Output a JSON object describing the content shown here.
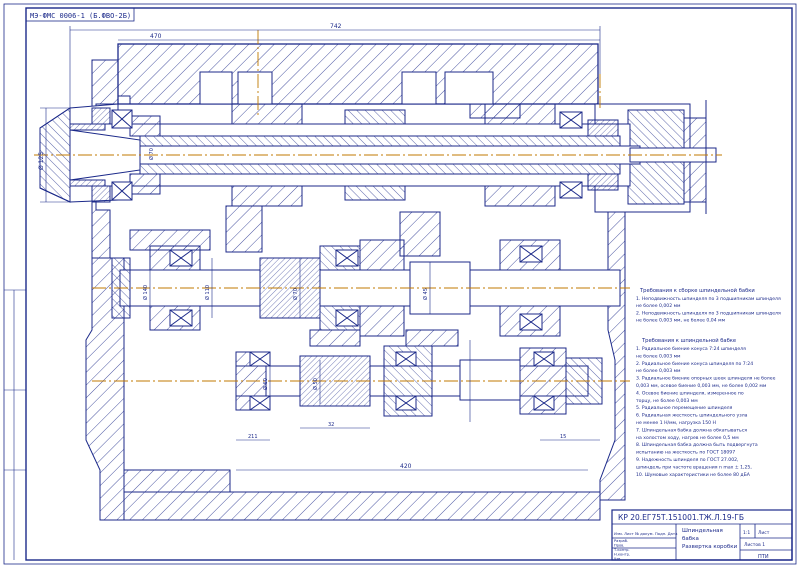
{
  "drawing": {
    "stamp_number": "МЭ-ФМС 0006-1 (Б.ФВО-2Б)",
    "title_code": "КР 20.ЕГ75Т.151001.ТЖ.Л.19-ГБ",
    "title_name_1": "Шпиндельная",
    "title_name_2": "бабка",
    "title_name_3": "Развертка коробки",
    "sheet_label": "Лист",
    "sheets_label": "Листов 1",
    "scale": "1:1",
    "org": "ПТИ"
  },
  "notes": {
    "heading_1": "Требования к сборке шпиндельной бабки",
    "lines_1": [
      "1. Неподвижность шпинделя по 3 подшипникам шпинделя",
      "не более 0,002 мм",
      "2. Неподвижность шпинделя по 3 подшипникам шпинделя",
      "не более 0,003 мм, не более 0,04 мм"
    ],
    "heading_2": "Требования к шпиндельной бабке",
    "lines_2": [
      "1. Радиальное биение конуса 7:24 шпинделя",
      "не более 0,003 мм",
      "2. Радиальное биение конуса шпинделя по 7:24",
      "не более 0,003 мм",
      "3. Радиальное биение опорных шеек шпинделя не более",
      "0,003 мм, осевое биение 0,003 мм, не более 0,002 мм",
      "4. Осевое биение шпинделя, измеренное по",
      "торцу, не более 0,003 мм",
      "5. Радиальное перемещение шпинделя",
      "6. Радиальная жесткость шпиндельного узла",
      "не менее 1 Н/мм, нагрузка 150 Н",
      "7. Шпиндельная бабка должна обкатываться",
      "на холостом ходу, нагрев не более 0,5 мм",
      "8. Шпиндельная бабка должна быть подвергнута",
      "испытанию на жесткость по ГОСТ 18097",
      "9. Надежность шпинделя по ГОСТ 27.002,",
      "шпиндель при частоте вращения n max ± 1,25,",
      "10. Шумовые характеристики не более 80 дБА"
    ]
  },
  "legend": {
    "label": "Изм. Лист № докум. Подп. Дата",
    "rows": [
      "Разраб.",
      "Пров.",
      "Т.контр.",
      "Н.контр.",
      "Утв."
    ]
  },
  "dims": {
    "overall": "742",
    "top": "470",
    "left_dia": "Ø 125",
    "spindle": "Ø 70",
    "shaft_a": "Ø 140",
    "shaft_b": "Ø 110",
    "shaft_c": "Ø 70",
    "shaft_d": "Ø 45",
    "lower": "211",
    "lower2": "Ø 60",
    "lower3": "420",
    "lower4": "32",
    "lower5": "Ø 50",
    "lower6": "15"
  },
  "colors": {
    "ink": "#1c2a8a",
    "centerline": "#c07a00",
    "hatch": "#1c2a8a",
    "paper": "#ffffff"
  }
}
